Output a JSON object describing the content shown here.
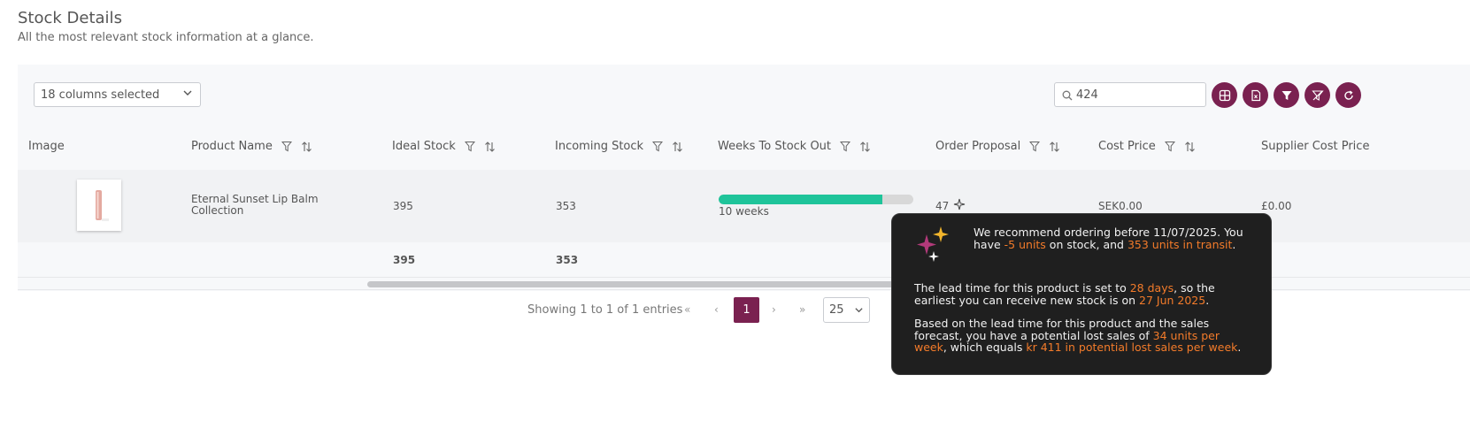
{
  "page": {
    "title": "Stock Details",
    "subtitle": "All the most relevant stock information at a glance."
  },
  "toolbar": {
    "columns_select": "18 columns selected",
    "search_value": "424",
    "buttons": [
      "table-view-icon",
      "export-excel-icon",
      "filter-icon",
      "clear-filter-icon",
      "refresh-icon"
    ]
  },
  "table": {
    "headers": [
      "Image",
      "Product Name",
      "Ideal Stock",
      "Incoming Stock",
      "Weeks To Stock Out",
      "Order Proposal",
      "Cost Price",
      "Supplier Cost Price"
    ],
    "row": {
      "product_name": "Eternal Sunset Lip Balm Collection",
      "ideal_stock": "395",
      "incoming_stock": "353",
      "weeks_to_stock_out": "10 weeks",
      "weeks_progress": 0.84,
      "order_proposal": "47",
      "cost_price": "SEK0.00",
      "supplier_cost_price": "£0.00"
    },
    "totals": {
      "ideal_stock": "395",
      "incoming_stock": "353"
    }
  },
  "pagination": {
    "info": "Showing 1 to 1 of 1 entries",
    "first": "«",
    "prev": "‹",
    "current": "1",
    "next": "›",
    "last": "»",
    "per_page": "25"
  },
  "tooltip": {
    "p1_a": "We recommend ordering before 11/07/2025. You have ",
    "p1_b": "-5 units",
    "p1_c": " on stock, and ",
    "p1_d": "353 units in transit",
    "p1_e": ".",
    "p2_a": "The lead time for this product is set to ",
    "p2_b": "28 days",
    "p2_c": ", so the earliest you can receive new stock is on ",
    "p2_d": "27 Jun 2025",
    "p2_e": ".",
    "p3_a": "Based on the lead time for this product and the sales forecast, you have a potential lost sales of ",
    "p3_b": "34 units per week",
    "p3_c": ", which equals ",
    "p3_d": "kr 411 in potential lost sales per week",
    "p3_e": "."
  },
  "colors": {
    "accent": "#7a2150",
    "progress": "#1fc49a",
    "highlight": "#f37b2a",
    "tooltip_bg": "#1f1f1f"
  }
}
